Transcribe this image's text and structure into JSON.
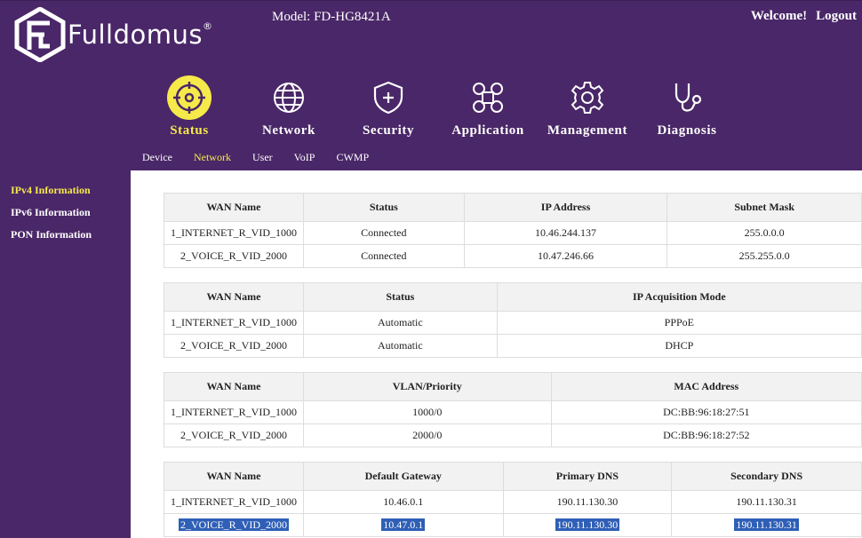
{
  "header": {
    "brand": "Fulldomus",
    "brand_mark": "®",
    "model": "Model: FD-HG8421A",
    "welcome": "Welcome!",
    "logout": "Logout"
  },
  "nav": {
    "items": [
      {
        "label": "Status",
        "icon": "status-icon"
      },
      {
        "label": "Network",
        "icon": "globe-icon"
      },
      {
        "label": "Security",
        "icon": "shield-icon"
      },
      {
        "label": "Application",
        "icon": "apps-icon"
      },
      {
        "label": "Management",
        "icon": "gear-icon"
      },
      {
        "label": "Diagnosis",
        "icon": "stethoscope-icon"
      }
    ],
    "active": "Status"
  },
  "subnav": {
    "items": [
      "Device",
      "Network",
      "User",
      "VoIP",
      "CWMP"
    ],
    "active": "Network"
  },
  "sidebar": {
    "items": [
      "IPv4 Information",
      "IPv6 Information",
      "PON Information"
    ],
    "active": "IPv4 Information"
  },
  "colors": {
    "header_bg": "#4a2768",
    "accent": "#f6e94a",
    "selection": "#2f5fb6"
  },
  "tables": [
    {
      "headers": [
        "WAN Name",
        "Status",
        "IP Address",
        "Subnet Mask"
      ],
      "rows": [
        [
          "1_INTERNET_R_VID_1000",
          "Connected",
          "10.46.244.137",
          "255.0.0.0"
        ],
        [
          "2_VOICE_R_VID_2000",
          "Connected",
          "10.47.246.66",
          "255.255.0.0"
        ]
      ]
    },
    {
      "headers": [
        "WAN Name",
        "Status",
        "IP Acquisition Mode"
      ],
      "rows": [
        [
          "1_INTERNET_R_VID_1000",
          "Automatic",
          "PPPoE"
        ],
        [
          "2_VOICE_R_VID_2000",
          "Automatic",
          "DHCP"
        ]
      ]
    },
    {
      "headers": [
        "WAN Name",
        "VLAN/Priority",
        "MAC Address"
      ],
      "rows": [
        [
          "1_INTERNET_R_VID_1000",
          "1000/0",
          "DC:BB:96:18:27:51"
        ],
        [
          "2_VOICE_R_VID_2000",
          "2000/0",
          "DC:BB:96:18:27:52"
        ]
      ]
    },
    {
      "headers": [
        "WAN Name",
        "Default Gateway",
        "Primary DNS",
        "Secondary DNS"
      ],
      "rows": [
        [
          "1_INTERNET_R_VID_1000",
          "10.46.0.1",
          "190.11.130.30",
          "190.11.130.31"
        ],
        [
          "2_VOICE_R_VID_2000",
          "10.47.0.1",
          "190.11.130.30",
          "190.11.130.31"
        ]
      ]
    }
  ]
}
